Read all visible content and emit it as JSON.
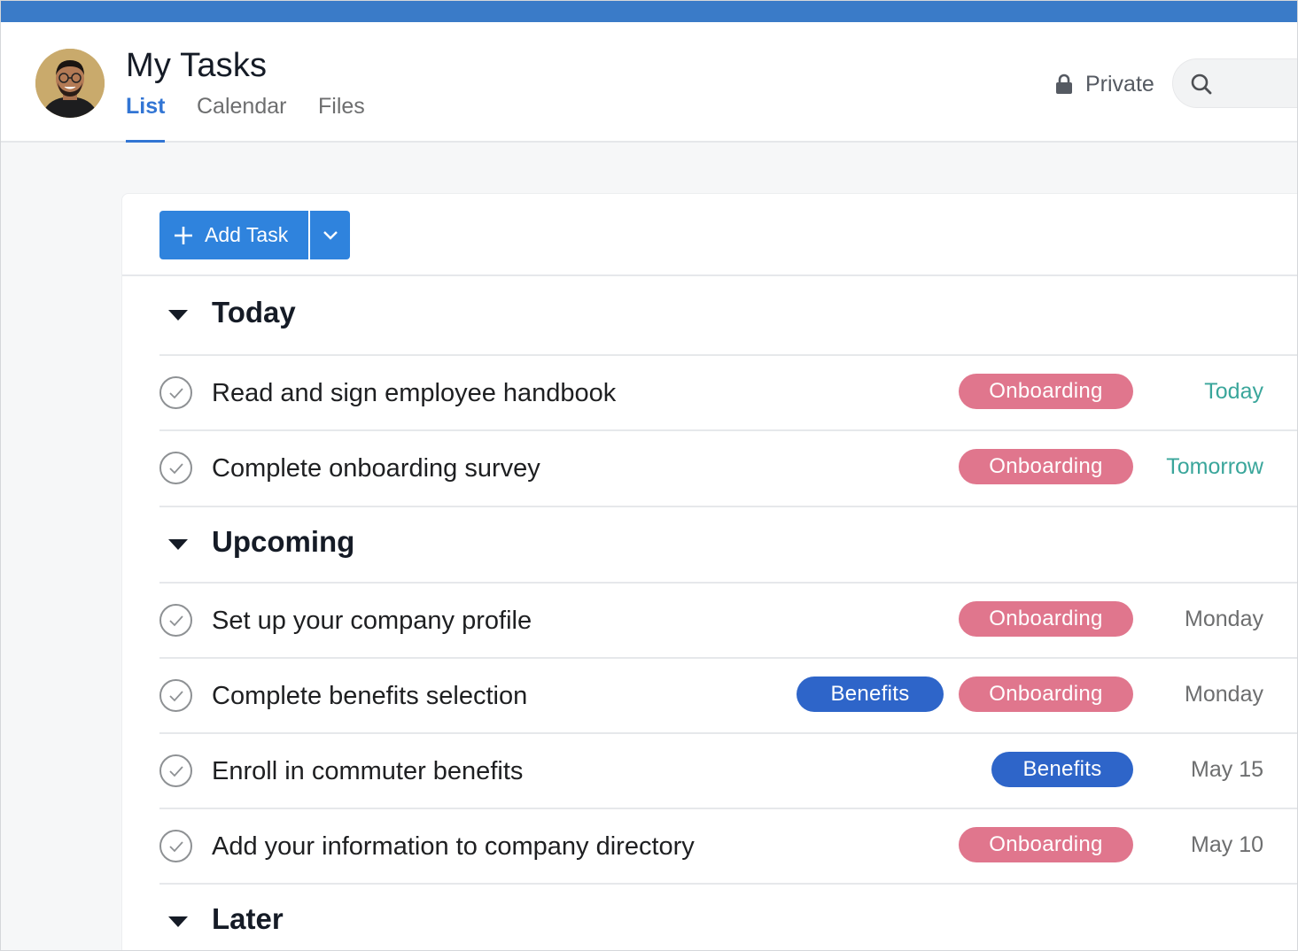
{
  "header": {
    "title": "My Tasks",
    "tabs": [
      {
        "label": "List",
        "active": true
      },
      {
        "label": "Calendar",
        "active": false
      },
      {
        "label": "Files",
        "active": false
      }
    ],
    "privacy_label": "Private"
  },
  "toolbar": {
    "add_task_label": "Add Task"
  },
  "sections": [
    {
      "label": "Today",
      "tasks": [
        {
          "name": "Read and sign employee handbook",
          "tags": [
            "Onboarding"
          ],
          "due": "Today"
        },
        {
          "name": "Complete onboarding survey",
          "tags": [
            "Onboarding"
          ],
          "due": "Tomorrow"
        }
      ]
    },
    {
      "label": "Upcoming",
      "tasks": [
        {
          "name": "Set up your company profile",
          "tags": [
            "Onboarding"
          ],
          "due": "Monday"
        },
        {
          "name": "Complete benefits selection",
          "tags": [
            "Benefits",
            "Onboarding"
          ],
          "due": "Monday"
        },
        {
          "name": "Enroll in commuter benefits",
          "tags": [
            "Benefits"
          ],
          "due": "May 15"
        },
        {
          "name": "Add your information to company directory",
          "tags": [
            "Onboarding"
          ],
          "due": "May 10"
        }
      ]
    },
    {
      "label": "Later",
      "tasks": []
    }
  ],
  "colors": {
    "top_bar": "#3a7bc8",
    "accent": "#3275d4",
    "onboarding_tag": "#e0768d",
    "benefits_tag": "#2e65c9",
    "due_soon": "#3aa69b"
  },
  "icons": {
    "privacy": "lock-icon",
    "search": "search-icon",
    "add": "plus-icon",
    "dropdown": "chevron-down-icon",
    "section_toggle": "caret-down-icon",
    "task_complete": "check-circle-icon"
  }
}
